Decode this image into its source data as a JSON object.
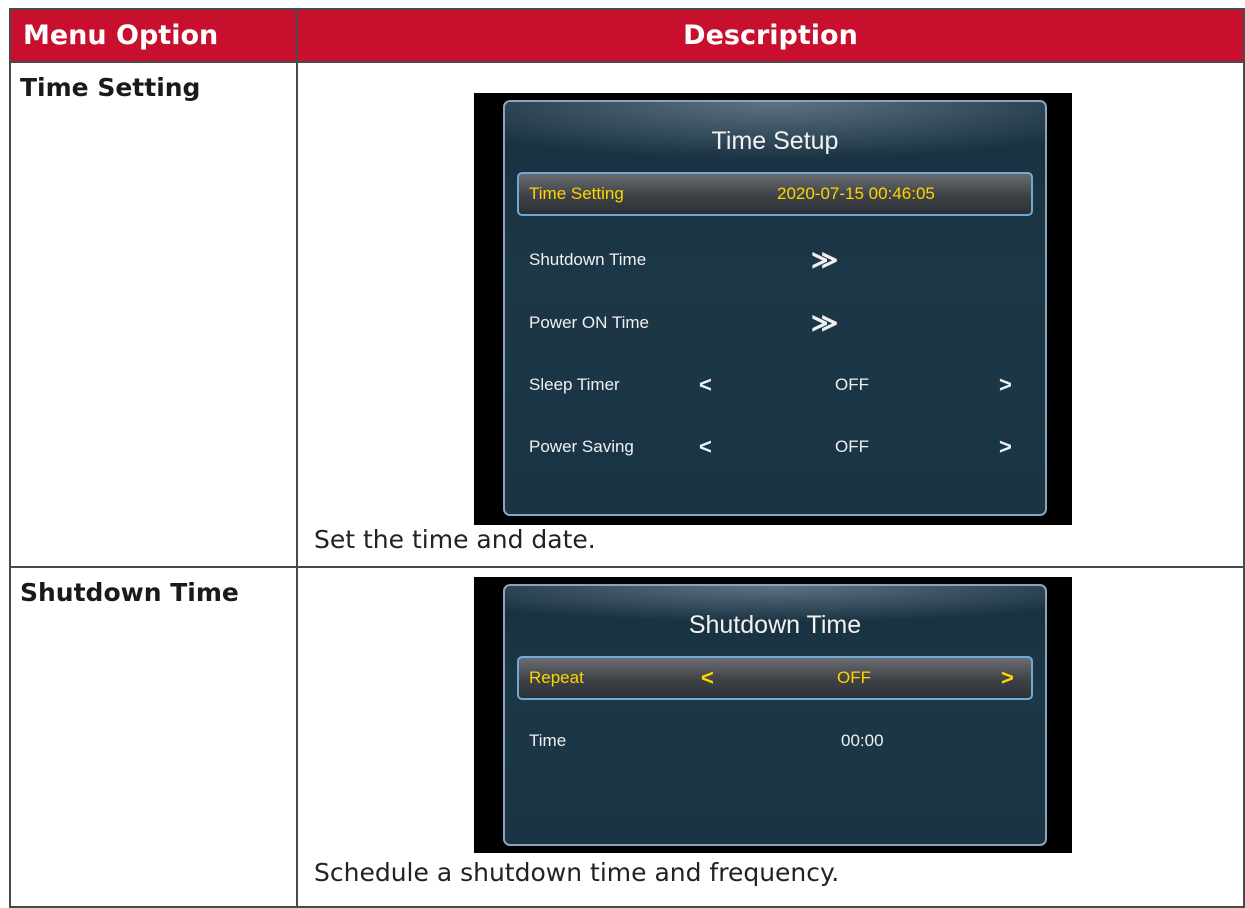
{
  "table": {
    "header_option": "Menu Option",
    "header_description": "Description"
  },
  "rows": [
    {
      "option": "Time Setting",
      "osd": {
        "title": "Time Setup",
        "items": [
          {
            "label": "Time Setting",
            "value": "2020-07-15 00:46:05"
          },
          {
            "label": "Shutdown Time",
            "value": "≫"
          },
          {
            "label": "Power ON Time",
            "value": "≫"
          },
          {
            "label": "Sleep Timer",
            "left_arrow": "<",
            "value": "OFF",
            "right_arrow": ">"
          },
          {
            "label": "Power Saving",
            "left_arrow": "<",
            "value": "OFF",
            "right_arrow": ">"
          }
        ]
      },
      "description": "Set the time and date."
    },
    {
      "option": "Shutdown Time",
      "osd": {
        "title": "Shutdown Time",
        "items": [
          {
            "label": "Repeat",
            "left_arrow": "<",
            "value": "OFF",
            "right_arrow": ">"
          },
          {
            "label": "Time",
            "value": "00:00"
          }
        ]
      },
      "description": "Schedule a shutdown time and frequency."
    }
  ],
  "colors": {
    "header_bg": "#c8102e",
    "highlight_text": "#ffd400",
    "osd_border": "#8aa4bd"
  }
}
